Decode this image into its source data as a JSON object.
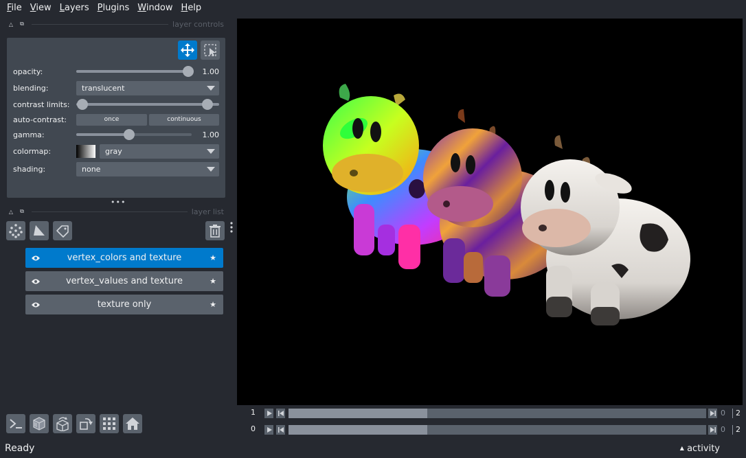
{
  "menu": [
    {
      "first": "F",
      "rest": "ile"
    },
    {
      "first": "V",
      "rest": "iew"
    },
    {
      "first": "L",
      "rest": "ayers"
    },
    {
      "first": "P",
      "rest": "lugins"
    },
    {
      "first": "W",
      "rest": "indow"
    },
    {
      "first": "H",
      "rest": "elp"
    }
  ],
  "docks": {
    "controls_title": "layer controls",
    "list_title": "layer list"
  },
  "controls": {
    "opacity": {
      "label": "opacity:",
      "value": "1.00",
      "fraction": 1.0
    },
    "blending": {
      "label": "blending:",
      "value": "translucent"
    },
    "contrast": {
      "label": "contrast limits:",
      "low": 0.0,
      "high": 1.0
    },
    "auto_contrast": {
      "label": "auto-contrast:",
      "once": "once",
      "continuous": "continuous"
    },
    "gamma": {
      "label": "gamma:",
      "value": "1.00",
      "fraction": 0.5
    },
    "colormap": {
      "label": "colormap:",
      "value": "gray"
    },
    "shading": {
      "label": "shading:",
      "value": "none"
    }
  },
  "layers": [
    {
      "name": "vertex_colors and texture",
      "selected": true
    },
    {
      "name": "vertex_values and texture",
      "selected": false
    },
    {
      "name": "texture only",
      "selected": false
    }
  ],
  "dims": [
    {
      "axis": "1",
      "current": "0",
      "max": "2",
      "fraction": 0.33
    },
    {
      "axis": "0",
      "current": "0",
      "max": "2",
      "fraction": 0.33
    }
  ],
  "status": "Ready",
  "activity": "activity",
  "colors": {
    "accent": "#007acc",
    "panel": "#414851",
    "background": "#262930",
    "button": "#5a626c"
  }
}
